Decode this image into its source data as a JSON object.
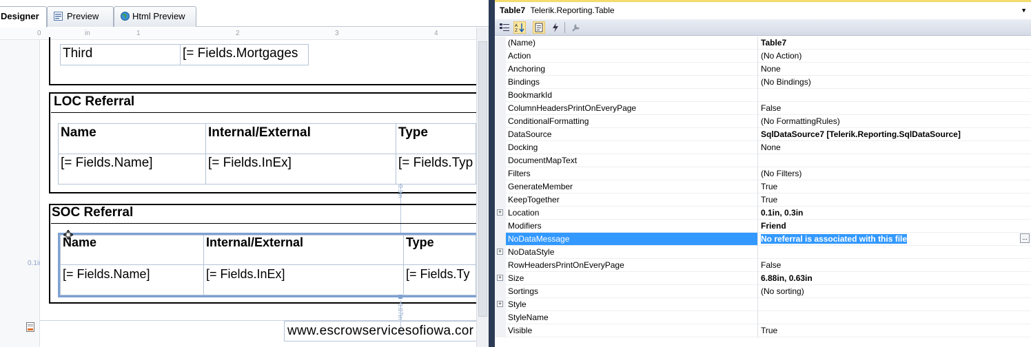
{
  "designer": {
    "tabs": [
      {
        "label": "Designer",
        "icon": "designer-icon"
      },
      {
        "label": "Preview",
        "icon": "preview-icon"
      },
      {
        "label": "Html Preview",
        "icon": "globe-icon"
      }
    ],
    "ruler": {
      "ticks": [
        "0",
        "in",
        "1",
        "2",
        "3",
        "4"
      ]
    },
    "mortgage_row": {
      "label": "Third",
      "field": "[= Fields.Mortgages"
    },
    "loc": {
      "title": "LOC Referral",
      "headers": [
        "Name",
        "Internal/External",
        "Type"
      ],
      "fields": [
        "[= Fields.Name]",
        "[= Fields.InEx]",
        "[= Fields.Typ"
      ]
    },
    "soc": {
      "title": "SOC Referral",
      "headers": [
        "Name",
        "Internal/External",
        "Type"
      ],
      "fields": [
        "[= Fields.Name]",
        "[= Fields.InEx]",
        "[= Fields.Ty"
      ]
    },
    "dim_labels": {
      "v_top": "0.3in",
      "h_left": "0.1in",
      "v_bottom": "0.07in"
    },
    "footer_text": "www.escrowservicesofiowa.cor"
  },
  "properties": {
    "header": {
      "name": "Table7",
      "type": "Telerik.Reporting.Table"
    },
    "toolbar": [
      "categorized-icon",
      "alphabetical-icon",
      "properties-icon",
      "events-icon",
      "property-pages-icon"
    ],
    "rows": [
      {
        "name": "(Name)",
        "value": "Table7",
        "bold": true
      },
      {
        "name": "Action",
        "value": "(No Action)"
      },
      {
        "name": "Anchoring",
        "value": "None"
      },
      {
        "name": "Bindings",
        "value": "(No Bindings)"
      },
      {
        "name": "BookmarkId",
        "value": ""
      },
      {
        "name": "ColumnHeadersPrintOnEveryPage",
        "value": "False"
      },
      {
        "name": "ConditionalFormatting",
        "value": "(No FormattingRules)"
      },
      {
        "name": "DataSource",
        "value": "SqlDataSource7 [Telerik.Reporting.SqlDataSource]",
        "bold": true
      },
      {
        "name": "Docking",
        "value": "None"
      },
      {
        "name": "DocumentMapText",
        "value": ""
      },
      {
        "name": "Filters",
        "value": "(No Filters)"
      },
      {
        "name": "GenerateMember",
        "value": "True"
      },
      {
        "name": "KeepTogether",
        "value": "True"
      },
      {
        "name": "Location",
        "value": "0.1in, 0.3in",
        "bold": true,
        "expand": true
      },
      {
        "name": "Modifiers",
        "value": "Friend",
        "bold": true
      },
      {
        "name": "NoDataMessage",
        "value": "No referral is associated with this file",
        "selected": true
      },
      {
        "name": "NoDataStyle",
        "value": "",
        "expand": true
      },
      {
        "name": "RowHeadersPrintOnEveryPage",
        "value": "False"
      },
      {
        "name": "Size",
        "value": "6.88in, 0.63in",
        "bold": true,
        "expand": true
      },
      {
        "name": "Sortings",
        "value": "(No sorting)"
      },
      {
        "name": "Style",
        "value": "",
        "expand": true
      },
      {
        "name": "StyleName",
        "value": ""
      },
      {
        "name": "Visible",
        "value": "True"
      }
    ],
    "expand_glyph": "+",
    "ellipsis_label": "..."
  }
}
